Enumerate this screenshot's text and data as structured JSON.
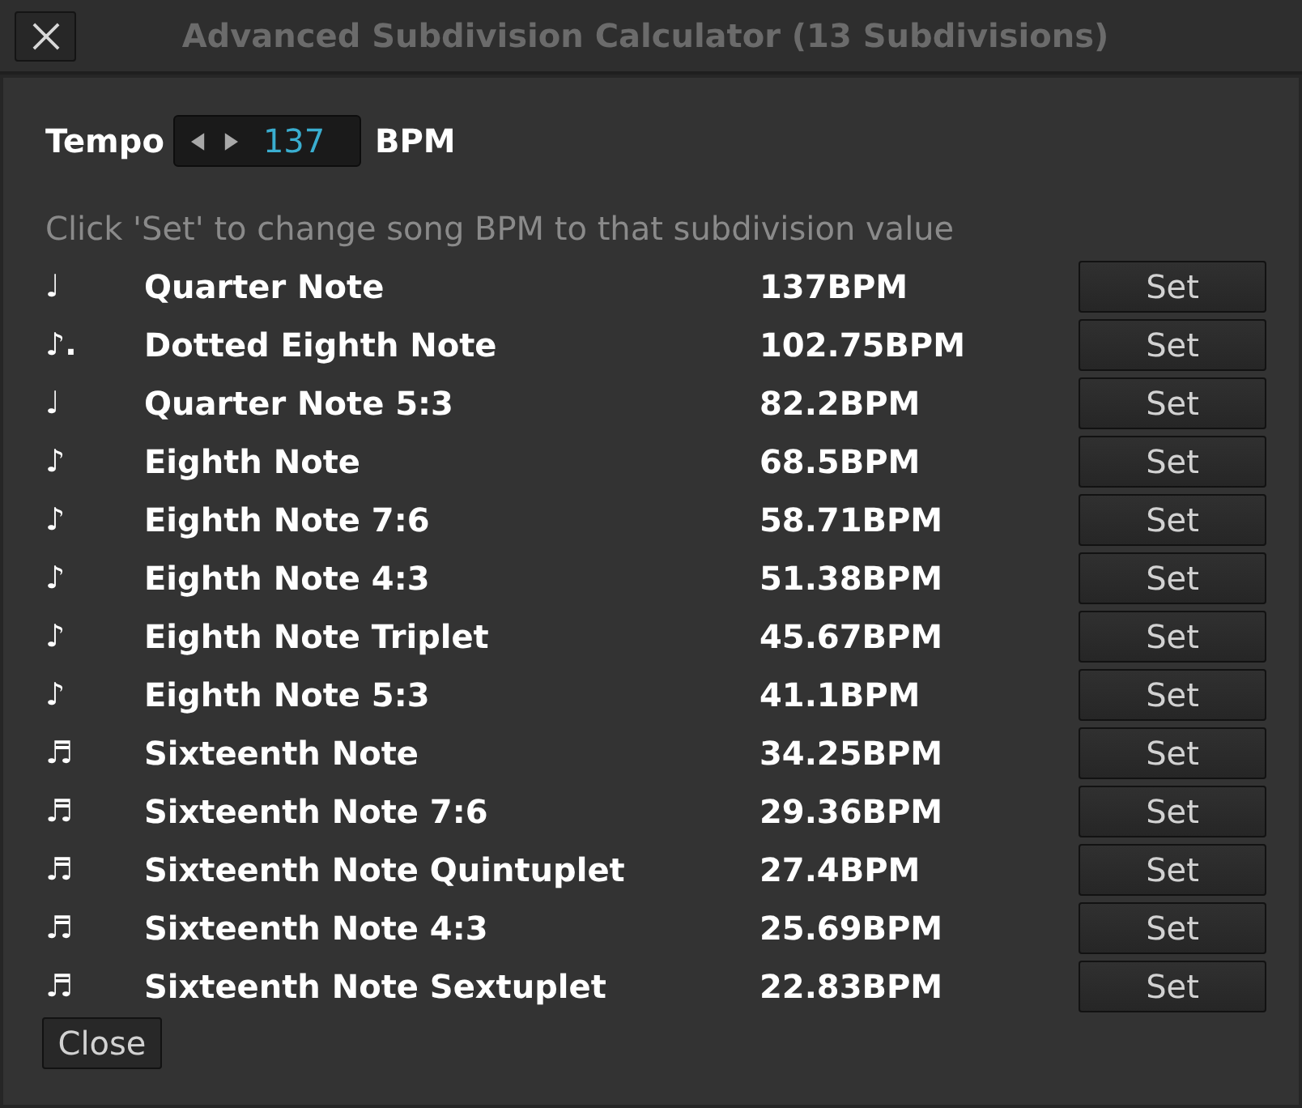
{
  "window": {
    "title": "Advanced Subdivision Calculator (13 Subdivisions)"
  },
  "tempo": {
    "label": "Tempo",
    "value": "137",
    "unit": "BPM"
  },
  "hint": "Click 'Set' to change song BPM to that subdivision value",
  "subdivisions": [
    {
      "symbol": "♩",
      "name": "Quarter Note",
      "bpm": "137BPM",
      "button": "Set"
    },
    {
      "symbol": "♪.",
      "name": "Dotted Eighth Note",
      "bpm": "102.75BPM",
      "button": "Set"
    },
    {
      "symbol": "♩",
      "name": "Quarter Note 5:3",
      "bpm": "82.2BPM",
      "button": "Set"
    },
    {
      "symbol": "♪",
      "name": "Eighth Note",
      "bpm": "68.5BPM",
      "button": "Set"
    },
    {
      "symbol": "♪",
      "name": "Eighth Note 7:6",
      "bpm": "58.71BPM",
      "button": "Set"
    },
    {
      "symbol": "♪",
      "name": "Eighth Note 4:3",
      "bpm": "51.38BPM",
      "button": "Set"
    },
    {
      "symbol": "♪",
      "name": "Eighth Note Triplet",
      "bpm": "45.67BPM",
      "button": "Set"
    },
    {
      "symbol": "♪",
      "name": "Eighth Note 5:3",
      "bpm": "41.1BPM",
      "button": "Set"
    },
    {
      "symbol": "♬",
      "name": "Sixteenth Note",
      "bpm": "34.25BPM",
      "button": "Set"
    },
    {
      "symbol": "♬",
      "name": "Sixteenth Note 7:6",
      "bpm": "29.36BPM",
      "button": "Set"
    },
    {
      "symbol": "♬",
      "name": "Sixteenth Note Quintuplet",
      "bpm": "27.4BPM",
      "button": "Set"
    },
    {
      "symbol": "♬",
      "name": "Sixteenth Note 4:3",
      "bpm": "25.69BPM",
      "button": "Set"
    },
    {
      "symbol": "♬",
      "name": "Sixteenth Note Sextuplet",
      "bpm": "22.83BPM",
      "button": "Set"
    }
  ],
  "buttons": [
    "Close"
  ]
}
